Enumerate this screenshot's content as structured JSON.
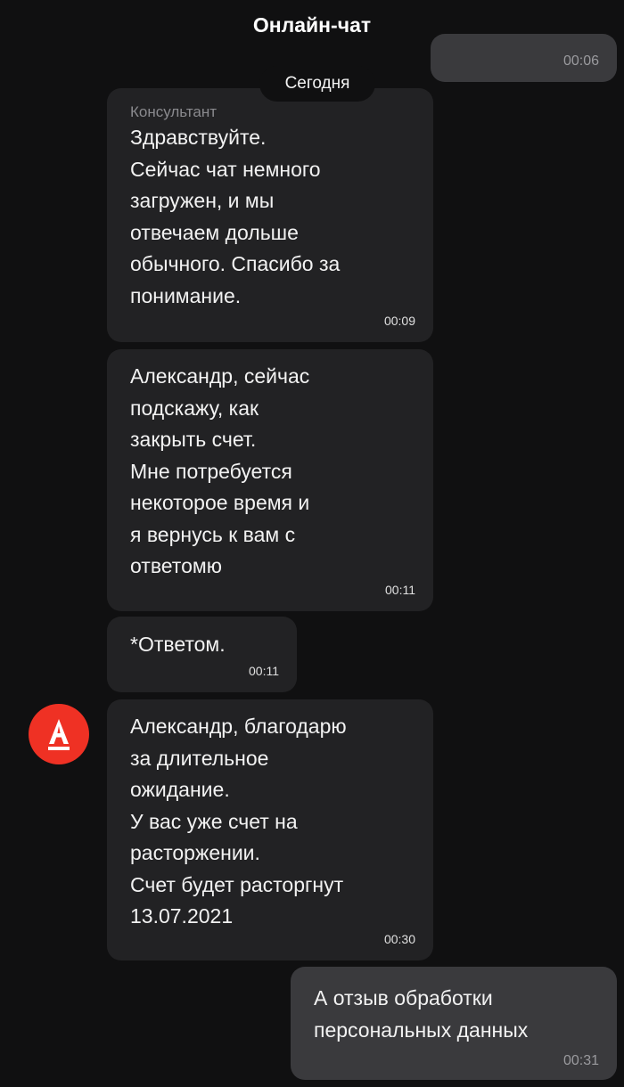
{
  "header": {
    "title": "Онлайн-чат"
  },
  "date_separator": "Сегодня",
  "messages": [
    {
      "direction": "out",
      "text": "",
      "time": "00:06"
    },
    {
      "direction": "in",
      "sender": "Консультант",
      "text": "Здравствуйте.\nСейчас чат немного\nзагружен, и мы\nотвечаем дольше\nобычного. Спасибо за\nпонимание.",
      "time": "00:09"
    },
    {
      "direction": "in",
      "text": "Александр, сейчас\nподскажу, как\nзакрыть счет.\nМне потребуется\nнекоторое время и\nя вернусь к вам с\nответомю",
      "time": "00:11"
    },
    {
      "direction": "in",
      "text": "*Ответом.",
      "time": "00:11"
    },
    {
      "direction": "in",
      "text": "Александр, благодарю\nза длительное\nожидание.\nУ вас уже счет на\nрасторжении.\nСчет будет расторгнут\n13.07.2021",
      "time": "00:30"
    },
    {
      "direction": "out",
      "text": "А отзыв обработки\nперсональных данных",
      "time": "00:31"
    }
  ],
  "colors": {
    "background": "#101011",
    "bubble_in": "#222224",
    "bubble_out": "#3a3a3d",
    "brand": "#ef3124"
  },
  "avatar": {
    "icon": "alfa-bank-logo-icon",
    "letter": "А"
  }
}
